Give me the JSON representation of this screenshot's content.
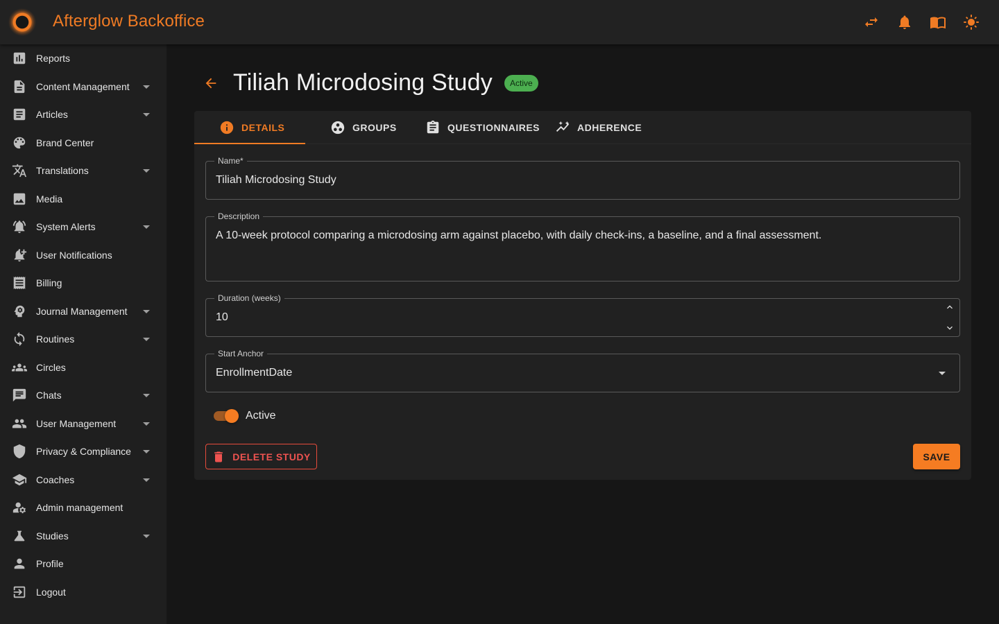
{
  "app": {
    "title": "Afterglow Backoffice"
  },
  "topbar": {
    "actions": [
      {
        "icon": "swap-icon"
      },
      {
        "icon": "bell-icon"
      },
      {
        "icon": "book-icon"
      },
      {
        "icon": "sun-icon"
      }
    ]
  },
  "sidebar": {
    "items": [
      {
        "label": "Reports",
        "icon": "reports-icon",
        "expandable": false
      },
      {
        "label": "Content Management",
        "icon": "document-icon",
        "expandable": true
      },
      {
        "label": "Articles",
        "icon": "article-icon",
        "expandable": true
      },
      {
        "label": "Brand Center",
        "icon": "palette-icon",
        "expandable": false
      },
      {
        "label": "Translations",
        "icon": "translate-icon",
        "expandable": true
      },
      {
        "label": "Media",
        "icon": "image-icon",
        "expandable": false
      },
      {
        "label": "System Alerts",
        "icon": "alarm-icon",
        "expandable": true
      },
      {
        "label": "User Notifications",
        "icon": "notification-add-icon",
        "expandable": false
      },
      {
        "label": "Billing",
        "icon": "receipt-icon",
        "expandable": false
      },
      {
        "label": "Journal Management",
        "icon": "psychology-icon",
        "expandable": true
      },
      {
        "label": "Routines",
        "icon": "sync-icon",
        "expandable": true
      },
      {
        "label": "Circles",
        "icon": "groups-icon",
        "expandable": false
      },
      {
        "label": "Chats",
        "icon": "chat-icon",
        "expandable": true
      },
      {
        "label": "User Management",
        "icon": "people-icon",
        "expandable": true
      },
      {
        "label": "Privacy & Compliance",
        "icon": "shield-icon",
        "expandable": true
      },
      {
        "label": "Coaches",
        "icon": "school-icon",
        "expandable": true
      },
      {
        "label": "Admin management",
        "icon": "manage-accounts-icon",
        "expandable": false
      },
      {
        "label": "Studies",
        "icon": "flask-icon",
        "expandable": true
      },
      {
        "label": "Profile",
        "icon": "person-icon",
        "expandable": false
      },
      {
        "label": "Logout",
        "icon": "logout-icon",
        "expandable": false
      }
    ]
  },
  "header": {
    "title": "Tiliah Microdosing Study",
    "status": "Active"
  },
  "tabs": [
    {
      "label": "DETAILS",
      "icon": "info-icon",
      "active": true
    },
    {
      "label": "GROUPS",
      "icon": "groups-circle-icon",
      "active": false
    },
    {
      "label": "QUESTIONNAIRES",
      "icon": "clipboard-icon",
      "active": false
    },
    {
      "label": "ADHERENCE",
      "icon": "trend-icon",
      "active": false
    }
  ],
  "form": {
    "name": {
      "label": "Name*",
      "value": "Tiliah Microdosing Study"
    },
    "description": {
      "label": "Description",
      "value": "A 10-week protocol comparing a microdosing arm against placebo, with daily check-ins, a baseline, and a final assessment."
    },
    "duration": {
      "label": "Duration (weeks)",
      "value": "10"
    },
    "start_anchor": {
      "label": "Start Anchor",
      "value": "EnrollmentDate"
    },
    "active": {
      "label": "Active",
      "checked": true
    }
  },
  "actions": {
    "delete_label": "DELETE STUDY",
    "save_label": "SAVE"
  },
  "colors": {
    "accent": "#f07b24",
    "danger": "#ef5350",
    "success": "#4caf50",
    "background": "#161616",
    "surface": "#212121"
  }
}
